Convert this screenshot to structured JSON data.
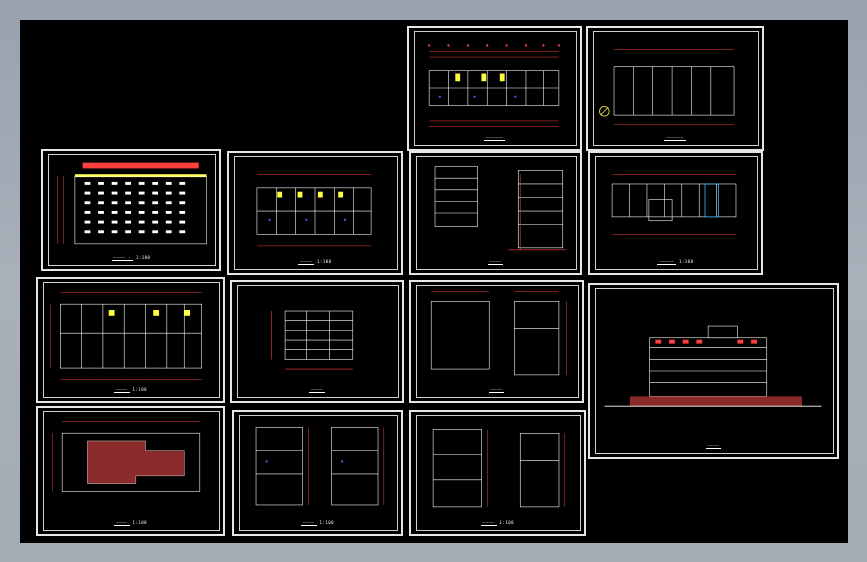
{
  "viewer": {
    "background_color": "#000000",
    "line_colors": {
      "frame": "#e6e6e6",
      "dimension": "#ff4040",
      "grid": "#ffffff",
      "accent_yellow": "#ffff40",
      "accent_blue": "#4060ff",
      "accent_cyan": "#40c0ff",
      "fill_brown": "#8a2a2a"
    }
  },
  "sheets": [
    {
      "id": "s1",
      "kind": "plan",
      "caption": "——————",
      "scale": ""
    },
    {
      "id": "s2",
      "kind": "plan",
      "caption": "——————",
      "scale": ""
    },
    {
      "id": "s3",
      "kind": "elevation",
      "caption": "———— ·",
      "scale": "1:100"
    },
    {
      "id": "s4",
      "kind": "plan",
      "caption": "————",
      "scale": "1:100"
    },
    {
      "id": "s5",
      "kind": "section",
      "caption": "————",
      "scale": ""
    },
    {
      "id": "s6",
      "kind": "plan",
      "caption": "—————",
      "scale": "1:100"
    },
    {
      "id": "s7",
      "kind": "plan",
      "caption": "————",
      "scale": "1:100"
    },
    {
      "id": "s8",
      "kind": "section",
      "caption": "————",
      "scale": ""
    },
    {
      "id": "s9",
      "kind": "plan-pair",
      "caption": "————",
      "scale": ""
    },
    {
      "id": "s10",
      "kind": "elevation",
      "caption": "————",
      "scale": ""
    },
    {
      "id": "s11",
      "kind": "plan",
      "caption": "————",
      "scale": "1:100"
    },
    {
      "id": "s12",
      "kind": "plan-pair",
      "caption": "————",
      "scale": "1:100"
    },
    {
      "id": "s13",
      "kind": "plan-pair",
      "caption": "————",
      "scale": "1:100"
    }
  ]
}
